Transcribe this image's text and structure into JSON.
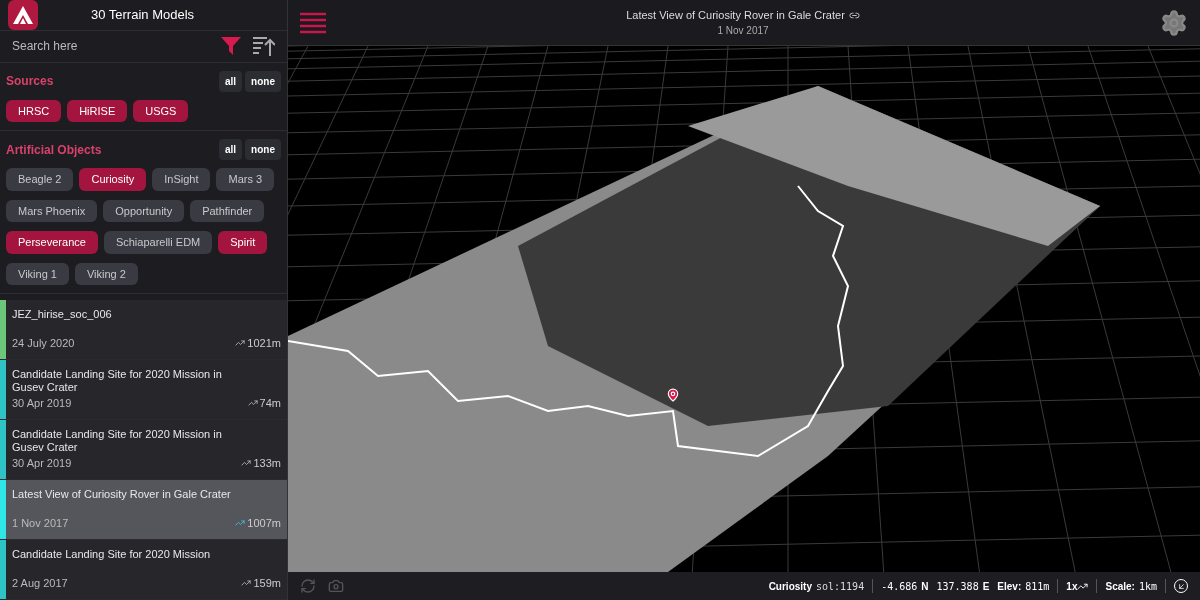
{
  "sidebar": {
    "title": "30 Terrain Models",
    "search": {
      "placeholder": "Search here"
    },
    "filter_groups": [
      {
        "title": "Sources",
        "buttons": [
          "all",
          "none"
        ],
        "chips": [
          {
            "label": "HRSC",
            "selected": true
          },
          {
            "label": "HiRISE",
            "selected": true
          },
          {
            "label": "USGS",
            "selected": true
          }
        ]
      },
      {
        "title": "Artificial Objects",
        "buttons": [
          "all",
          "none"
        ],
        "chips": [
          {
            "label": "Beagle 2",
            "selected": false
          },
          {
            "label": "Curiosity",
            "selected": true
          },
          {
            "label": "InSight",
            "selected": false
          },
          {
            "label": "Mars 3",
            "selected": false
          },
          {
            "label": "Mars Phoenix",
            "selected": false
          },
          {
            "label": "Opportunity",
            "selected": false
          },
          {
            "label": "Pathfinder",
            "selected": false
          },
          {
            "label": "Perseverance",
            "selected": true
          },
          {
            "label": "Schiaparelli EDM",
            "selected": false
          },
          {
            "label": "Spirit",
            "selected": true
          },
          {
            "label": "Viking 1",
            "selected": false
          },
          {
            "label": "Viking 2",
            "selected": false
          }
        ]
      }
    ],
    "models": [
      {
        "title": "JEZ_hirise_soc_006",
        "date": "24 July 2020",
        "elevation": "1021m",
        "color": "#6cc77a",
        "selected": false
      },
      {
        "title": "Candidate Landing Site for 2020 Mission in Gusev Crater",
        "date": "30 Apr 2019",
        "elevation": "74m",
        "color": "#2ec4c4",
        "selected": false
      },
      {
        "title": "Candidate Landing Site for 2020 Mission in Gusev Crater",
        "date": "30 Apr 2019",
        "elevation": "133m",
        "color": "#2ec4c4",
        "selected": false
      },
      {
        "title": "Latest View of Curiosity Rover in Gale Crater",
        "date": "1 Nov 2017",
        "elevation": "1007m",
        "color": "#2ee8e8",
        "selected": true
      },
      {
        "title": "Candidate Landing Site for 2020 Mission",
        "date": "2 Aug 2017",
        "elevation": "159m",
        "color": "#2ec4c4",
        "selected": false
      }
    ]
  },
  "header": {
    "title": "Latest View of Curiosity Rover in Gale Crater",
    "date": "1 Nov 2017"
  },
  "status_bar": {
    "rover": "Curiosity",
    "sol": "sol:1194",
    "latitude": "-4.686",
    "lat_dir": "N",
    "longitude": "137.388",
    "lon_dir": "E",
    "elev_label": "Elev:",
    "elev": "811m",
    "speed": "1x",
    "scale_label": "Scale:",
    "scale": "1km"
  }
}
